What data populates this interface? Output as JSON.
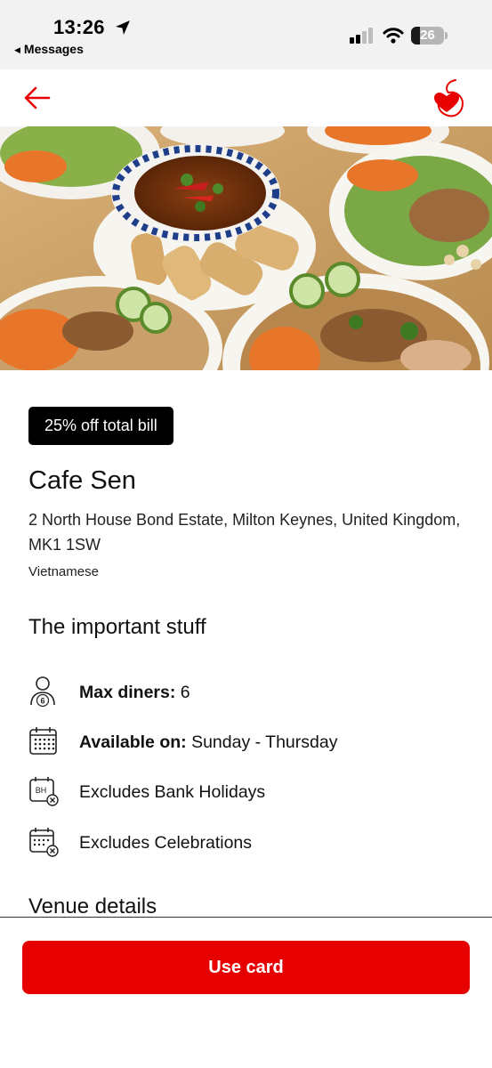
{
  "status_bar": {
    "time": "13:26",
    "back_app": "Messages",
    "battery": "26",
    "battery_level": 0.26,
    "icons": [
      "location-arrow-icon",
      "cellular-signal-icon",
      "wifi-icon",
      "battery-icon"
    ]
  },
  "header": {
    "back_icon": "arrow-left-icon",
    "logo_icon": "vodafone-heart-logo-icon"
  },
  "hero_image": "food-photo",
  "offer": {
    "badge": "25% off total bill",
    "name": "Cafe Sen",
    "address": "2 North House Bond Estate, Milton Keynes, United Kingdom, MK1 1SW",
    "cuisine": "Vietnamese"
  },
  "important": {
    "title": "The important stuff",
    "max_diners_label": "Max diners:",
    "max_diners_value": "6",
    "max_diners_icon_number": "6",
    "available_label": "Available on:",
    "available_value": "Sunday - Thursday",
    "bank_holidays": "Excludes Bank Holidays",
    "bank_holidays_icon_text": "BH",
    "celebrations": "Excludes Celebrations"
  },
  "venue_details": {
    "title": "Venue details"
  },
  "cta": {
    "label": "Use card"
  },
  "colors": {
    "brand_red": "#e60000",
    "badge_bg": "#000000",
    "status_bar_bg": "#f2f2f2"
  }
}
